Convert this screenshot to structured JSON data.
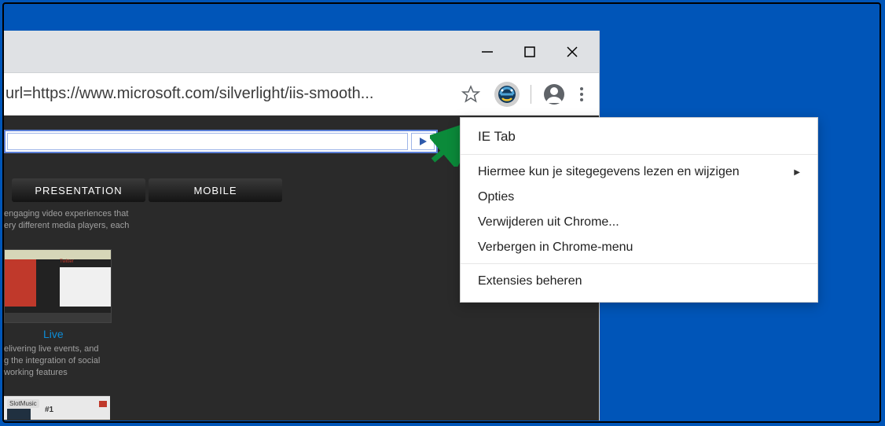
{
  "window": {
    "minimize": "—",
    "maximize": "☐",
    "close": "✕"
  },
  "omnibox": {
    "url": "url=https://www.microsoft.com/silverlight/iis-smooth..."
  },
  "page": {
    "tabs": [
      "PRESENTATION",
      "MOBILE"
    ],
    "intro1": "engaging video experiences that",
    "intro2": "ery different media players, each",
    "thumb_twitter": "Twitter",
    "live_link": "Live",
    "live_desc1": "elivering live events, and",
    "live_desc2": "g the integration of social",
    "live_desc3": "working features",
    "thumb2_brand": "SlotMusic",
    "thumb2_num": "#1"
  },
  "context_menu": {
    "title": "IE Tab",
    "items": [
      {
        "label": "Hiermee kun je sitegegevens lezen en wijzigen",
        "submenu": true
      },
      {
        "label": "Opties"
      },
      {
        "label": "Verwijderen uit Chrome..."
      },
      {
        "label": "Verbergen in Chrome-menu"
      }
    ],
    "manage": "Extensies beheren"
  }
}
